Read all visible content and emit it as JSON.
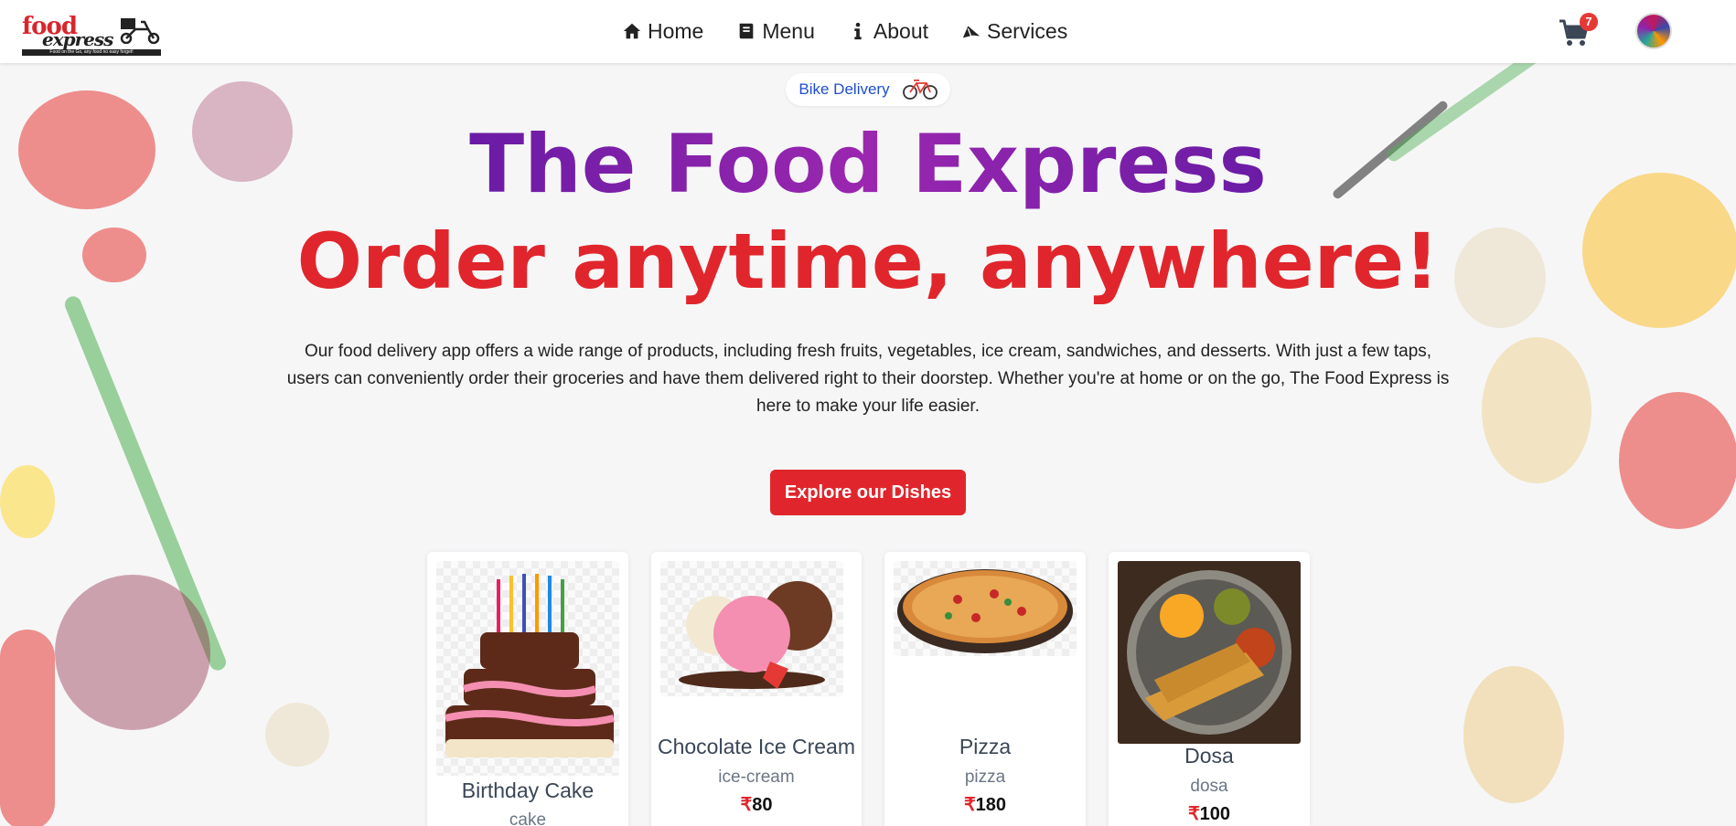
{
  "brand": {
    "logo_word1": "food",
    "logo_word2": "express",
    "logo_tagline": "Food on the Go, any food no easy forget!"
  },
  "nav": [
    {
      "label": "Home",
      "icon": "home-icon"
    },
    {
      "label": "Menu",
      "icon": "book-icon"
    },
    {
      "label": "About",
      "icon": "info-icon"
    },
    {
      "label": "Services",
      "icon": "services-icon"
    }
  ],
  "cart": {
    "count": "7"
  },
  "hero": {
    "pill_label": "Bike Delivery",
    "title": "The Food Express",
    "subtitle": "Order anytime, anywhere!",
    "description": "Our food delivery app offers a wide range of products, including fresh fruits, vegetables, ice cream, sandwiches, and desserts. With just a few taps, users can conveniently order their groceries and have them delivered right to their doorstep. Whether you're at home or on the go, The Food Express is here to make your life easier.",
    "cta_label": "Explore our Dishes"
  },
  "dishes": [
    {
      "name": "Birthday Cake",
      "category": "cake",
      "currency": "₹",
      "price": "",
      "image": "cake-image"
    },
    {
      "name": "Chocolate Ice Cream",
      "category": "ice-cream",
      "currency": "₹",
      "price": "80",
      "image": "ice-cream-image"
    },
    {
      "name": "Pizza",
      "category": "pizza",
      "currency": "₹",
      "price": "180",
      "image": "pizza-image"
    },
    {
      "name": "Dosa",
      "category": "dosa",
      "currency": "₹",
      "price": "100",
      "image": "dosa-image"
    }
  ],
  "colors": {
    "accent_red": "#e0262c",
    "title_purple": "#7b1fa2",
    "pill_blue": "#1e4dd1"
  }
}
